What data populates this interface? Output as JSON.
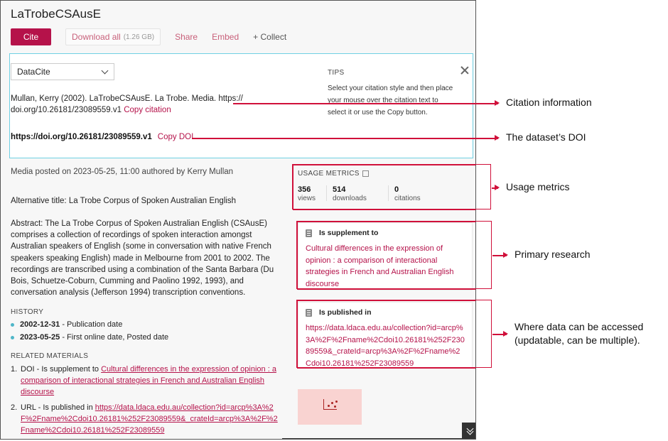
{
  "title": "LaTrobeCSAusE",
  "toolbar": {
    "cite_label": "Cite",
    "download_label": "Download all",
    "download_size": "(1.26 GB)",
    "share_label": "Share",
    "embed_label": "Embed",
    "collect_label": "+ Collect"
  },
  "cite_panel": {
    "style_selected": "DataCite",
    "citation_text": "Mullan, Kerry (2002). LaTrobeCSAusE. La Trobe. Media. https:// doi.org/10.26181/23089559.v1",
    "copy_citation_label": "Copy citation",
    "doi": "https://doi.org/10.26181/23089559.v1",
    "copy_doi_label": "Copy DOI",
    "tips_heading": "TIPS",
    "tips_text": "Select your citation style and then place your mouse over the citation text to select it or use the Copy button."
  },
  "meta_line": "Media posted on 2023-05-25, 11:00 authored by Kerry Mullan",
  "alternative_title": "Alternative title: La Trobe Corpus of Spoken Australian English",
  "abstract": "Abstract: The La Trobe Corpus of Spoken Australian English (CSAusE) comprises a collection of recordings of spoken interaction amongst Australian speakers of English (some in conversation with native French speakers speaking English) made in Melbourne from 2001 to 2002. The recordings are transcribed using a combination of the Santa Barbara (Du Bois, Schuetze-Coburn, Cumming and Paolino 1992, 1993), and conversation analysis (Jefferson 1994) transcription conventions.",
  "history": {
    "heading": "HISTORY",
    "items": [
      {
        "date": "2002-12-31",
        "label": " - Publication date"
      },
      {
        "date": "2023-05-25",
        "label": " - First online date, Posted date"
      }
    ]
  },
  "related": {
    "heading": "RELATED MATERIALS",
    "items": [
      {
        "num": "1.",
        "prefix": "DOI - Is supplement to ",
        "link": "Cultural differences in the expression of opinion : a comparison of interactional strategies in French and Australian English discourse"
      },
      {
        "num": "2.",
        "prefix": "URL - Is published in ",
        "link": "https://data.ldaca.edu.au/collection?id=arcp%3A%2F%2Fname%2Cdoi10.26181%252F23089559&_crateId=arcp%3A%2F%2Fname%2Cdoi10.26181%252F23089559"
      }
    ]
  },
  "metrics": {
    "heading": "USAGE METRICS",
    "views_value": "356",
    "views_label": "views",
    "downloads_value": "514",
    "downloads_label": "downloads",
    "citations_value": "0",
    "citations_label": "citations"
  },
  "supplement_card": {
    "heading": "Is supplement to",
    "link": "Cultural differences in the expression of opinion : a comparison of interactional strategies in French and Australian English discourse"
  },
  "published_card": {
    "heading": "Is published in",
    "link": "https://data.ldaca.edu.au/collection?id=arcp%3A%2F%2Fname%2Cdoi10.26181%252F23089559&_crateId=arcp%3A%2F%2Fname%2Cdoi10.26181%252F23089559"
  },
  "annotations": {
    "citation_info": "Citation information",
    "doi": "The dataset’s DOI",
    "usage_metrics": "Usage metrics",
    "primary_research": "Primary research",
    "access_line1": "Where data can be accessed",
    "access_line2": "(updatable, can be multiple)."
  },
  "colors": {
    "accent": "#b5124a",
    "panel_border": "#6fd0e3",
    "annotation_red": "#d0103a"
  }
}
